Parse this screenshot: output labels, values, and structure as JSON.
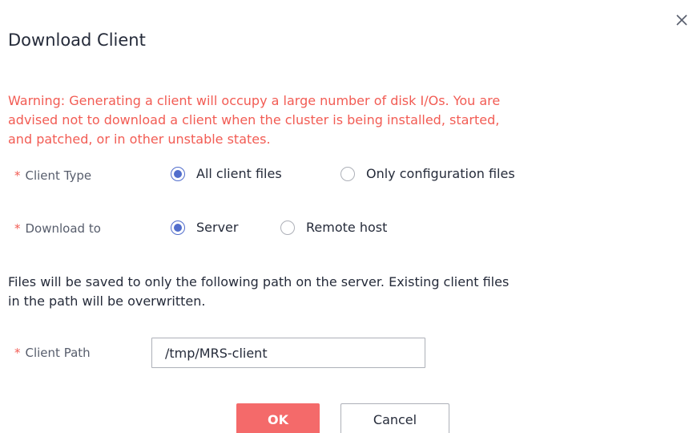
{
  "dialog": {
    "title": "Download Client",
    "close_icon": "close-icon"
  },
  "warning": {
    "lines": [
      "Warning: Generating a client will occupy a large number of disk I/Os. You are",
      "advised not to download a client when the cluster is being installed, started,",
      "and patched, or in other unstable states."
    ]
  },
  "client_type": {
    "label": "Client Type",
    "required_mark": "*",
    "options": [
      {
        "label": "All client files",
        "selected": true
      },
      {
        "label": "Only configuration files",
        "selected": false
      }
    ]
  },
  "download_to": {
    "label": "Download to",
    "required_mark": "*",
    "options": [
      {
        "label": "Server",
        "selected": true
      },
      {
        "label": "Remote host",
        "selected": false
      }
    ]
  },
  "info": {
    "lines": [
      "Files will be saved to only the following path on the server. Existing client files",
      "in the path will be overwritten."
    ]
  },
  "client_path": {
    "label": "Client Path",
    "required_mark": "*",
    "value": "/tmp/MRS-client"
  },
  "buttons": {
    "ok_label": "OK",
    "cancel_label": "Cancel"
  },
  "colors": {
    "warning": "#f25c54",
    "accent": "#526ecc",
    "ok_button": "#f46a6a"
  }
}
